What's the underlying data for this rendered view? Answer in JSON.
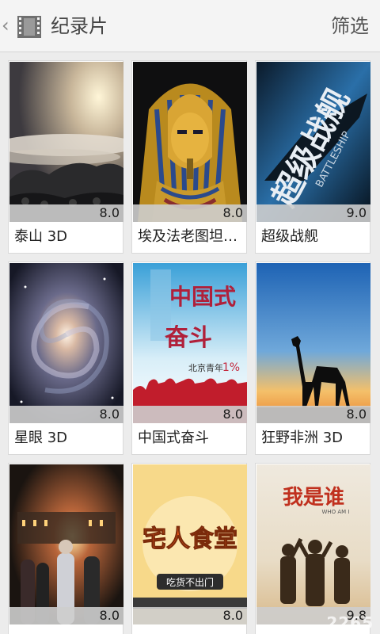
{
  "header": {
    "title": "纪录片",
    "filter_label": "筛选"
  },
  "items": [
    {
      "name": "泰山 3D",
      "rating": "8.0"
    },
    {
      "name": "埃及法老图坦…",
      "rating": "8.0"
    },
    {
      "name": "超级战舰",
      "rating": "9.0"
    },
    {
      "name": "星眼 3D",
      "rating": "8.0"
    },
    {
      "name": "中国式奋斗",
      "rating": "8.0"
    },
    {
      "name": "狂野非洲 3D",
      "rating": "8.0"
    },
    {
      "name": "",
      "rating": "8.0"
    },
    {
      "name": "",
      "rating": "8.0"
    },
    {
      "name": "",
      "rating": "9.8"
    }
  ],
  "posters": {
    "battleship": {
      "title": "超级战舰",
      "sub": "BATTLESHIP"
    },
    "struggle": {
      "title_1": "中国式",
      "title_2": "奋斗",
      "note": "北京青年",
      "pct": "1%"
    },
    "food": {
      "title": "宅人食堂",
      "sub": "吃货不出门"
    },
    "who": {
      "title": "我是谁",
      "sub": "WHO AM I"
    }
  },
  "watermark": "2265"
}
